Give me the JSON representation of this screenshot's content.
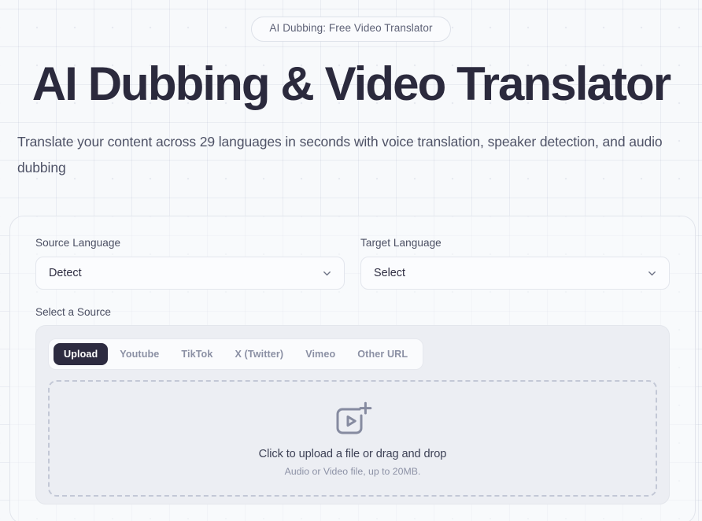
{
  "hero": {
    "badge": "AI Dubbing: Free Video Translator",
    "title": "AI Dubbing & Video Translator",
    "subtitle": "Translate your content across 29 languages in seconds with voice translation, speaker detection, and audio dubbing"
  },
  "form": {
    "source_language": {
      "label": "Source Language",
      "value": "Detect"
    },
    "target_language": {
      "label": "Target Language",
      "value": "Select"
    },
    "source_section_label": "Select a Source",
    "tabs": [
      {
        "label": "Upload",
        "active": true
      },
      {
        "label": "Youtube",
        "active": false
      },
      {
        "label": "TikTok",
        "active": false
      },
      {
        "label": "X (Twitter)",
        "active": false
      },
      {
        "label": "Vimeo",
        "active": false
      },
      {
        "label": "Other URL",
        "active": false
      }
    ],
    "dropzone": {
      "icon": "video-add-icon",
      "primary_text": "Click to upload a file or drag and drop",
      "secondary_text": "Audio or Video file, up to 20MB."
    }
  },
  "icons": {
    "chevron_down": "chevron-down-icon"
  },
  "colors": {
    "page_background": "#f7f9fb",
    "heading": "#2b2a3d",
    "accent_dark": "#2d2b40",
    "panel_background": "#eceef3",
    "border": "#e2e5ec",
    "muted_text": "#8b90a4"
  }
}
